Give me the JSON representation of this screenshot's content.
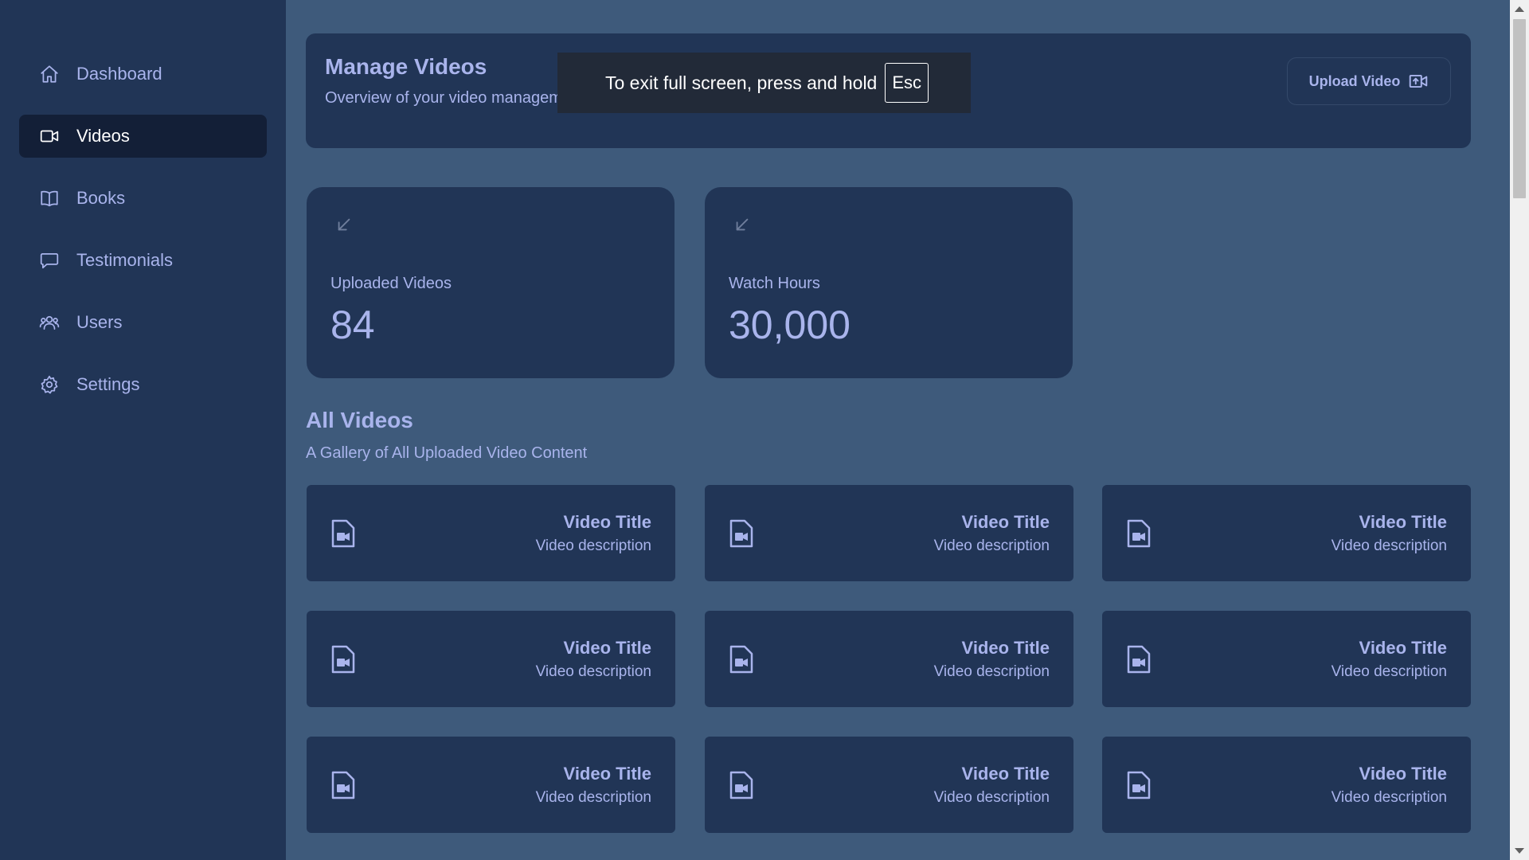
{
  "sidebar": {
    "items": [
      {
        "label": "Dashboard",
        "icon": "home-icon",
        "active": false
      },
      {
        "label": "Videos",
        "icon": "video-camera-icon",
        "active": true
      },
      {
        "label": "Books",
        "icon": "book-icon",
        "active": false
      },
      {
        "label": "Testimonials",
        "icon": "chat-bubble-icon",
        "active": false
      },
      {
        "label": "Users",
        "icon": "users-icon",
        "active": false
      },
      {
        "label": "Settings",
        "icon": "gear-icon",
        "active": false
      }
    ]
  },
  "header": {
    "title": "Manage Videos",
    "subtitle": "Overview of your video management and key insights.",
    "upload_label": "Upload Video",
    "upload_icon": "video-upload-icon"
  },
  "toast": {
    "text": "To exit full screen, press and hold",
    "key": "Esc"
  },
  "stats": [
    {
      "label": "Uploaded Videos",
      "value": "84",
      "icon": "arrow-down-left-icon"
    },
    {
      "label": "Watch Hours",
      "value": "30,000",
      "icon": "arrow-down-left-icon"
    }
  ],
  "gallery": {
    "title": "All Videos",
    "subtitle": "A Gallery of All Uploaded Video Content",
    "videos": [
      {
        "title": "Video Title",
        "description": "Video description"
      },
      {
        "title": "Video Title",
        "description": "Video description"
      },
      {
        "title": "Video Title",
        "description": "Video description"
      },
      {
        "title": "Video Title",
        "description": "Video description"
      },
      {
        "title": "Video Title",
        "description": "Video description"
      },
      {
        "title": "Video Title",
        "description": "Video description"
      },
      {
        "title": "Video Title",
        "description": "Video description"
      },
      {
        "title": "Video Title",
        "description": "Video description"
      },
      {
        "title": "Video Title",
        "description": "Video description"
      }
    ]
  },
  "colors": {
    "page_background": "#3e5a7b",
    "panel": "#213556",
    "active_nav": "#131f37",
    "text": "#a9b4ec"
  }
}
